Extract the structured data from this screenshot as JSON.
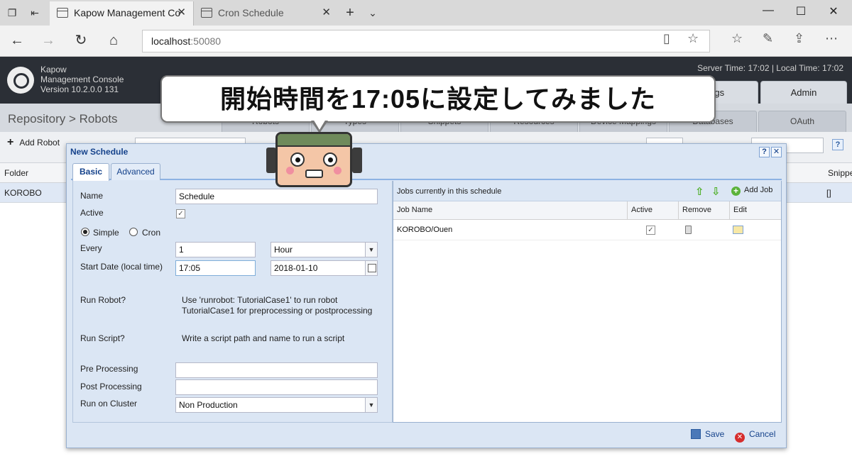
{
  "browser": {
    "tabs": [
      {
        "label": "Kapow Management Co"
      },
      {
        "label": "Cron Schedule"
      }
    ],
    "url_host": "localhost",
    "url_port": ":50080"
  },
  "app": {
    "title_line1": "Kapow",
    "title_line2": "Management Console",
    "title_line3": "Version 10.2.0.0 131",
    "server_time": "Server Time: 17:02  |  Local Time: 17:02",
    "top_tabs": [
      "Logs",
      "Admin"
    ],
    "breadcrumb": "Repository > Robots",
    "sub_tabs": [
      "Robots",
      "Types",
      "Snippets",
      "Resources",
      "Device Mappings",
      "Databases",
      "OAuth"
    ],
    "toolbar": {
      "add_robot": "Add Robot"
    },
    "grid": {
      "headers": {
        "folder": "Folder",
        "snippets": "Snippe"
      },
      "row": {
        "folder": "KOROBO",
        "snippets": "[]"
      }
    }
  },
  "dialog": {
    "title": "New Schedule",
    "tabs": [
      "Basic",
      "Advanced"
    ],
    "fields": {
      "name_label": "Name",
      "name_value": "Schedule",
      "active_label": "Active",
      "simple_label": "Simple",
      "cron_label": "Cron",
      "every_label": "Every",
      "every_value": "1",
      "every_unit": "Hour",
      "start_label": "Start Date (local time)",
      "start_time": "17:05",
      "start_date": "2018-01-10",
      "run_robot_label": "Run Robot?",
      "run_robot_help_1": "Use 'runrobot: TutorialCase1' to run robot",
      "run_robot_help_2": "TutorialCase1 for preprocessing or postprocessing",
      "run_script_label": "Run Script?",
      "run_script_help": "Write a script path and name to run a script",
      "pre_label": "Pre Processing",
      "pre_value": "",
      "post_label": "Post Processing",
      "post_value": "",
      "cluster_label": "Run on Cluster",
      "cluster_value": "Non Production"
    },
    "jobs": {
      "title": "Jobs currently in this schedule",
      "add_job": "Add Job",
      "columns": {
        "name": "Job Name",
        "active": "Active",
        "remove": "Remove",
        "edit": "Edit"
      },
      "rows": [
        {
          "name": "KOROBO/Ouen",
          "active": true
        }
      ]
    },
    "footer": {
      "save": "Save",
      "cancel": "Cancel"
    }
  },
  "caption": "開始時間を17:05に設定してみました",
  "icons": {
    "mascot": "robot-mascot-icon"
  }
}
